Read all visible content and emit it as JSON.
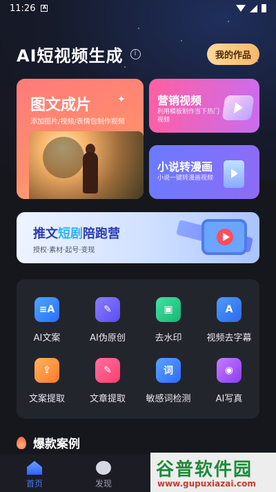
{
  "status_bar": {
    "time": "11:26",
    "a_badge": "A"
  },
  "header": {
    "title": "AI短视频生成",
    "info_glyph": "i",
    "my_works_label": "我的作品"
  },
  "cards": {
    "big": {
      "title": "图文成片",
      "subtitle": "添加图片/视频/表情包制作视频"
    },
    "top_right": {
      "title": "营销视频",
      "subtitle": "利用模板制作当下热门视频"
    },
    "bottom_right": {
      "title": "小说转漫画",
      "subtitle": "小说一键转漫画视频"
    }
  },
  "banner": {
    "title_part1": "推文",
    "title_highlight": "短剧",
    "title_part2": "陪跑营",
    "subtitle": "授权·素材·起号·变现"
  },
  "tools": [
    {
      "label": "AI文案",
      "icon": "ai-copywriting-icon",
      "glyph": "≡A",
      "color1": "#4aa8ff",
      "color2": "#2f6bff"
    },
    {
      "label": "AI伪原创",
      "icon": "ai-rewrite-icon",
      "glyph": "✎",
      "color1": "#8a7dff",
      "color2": "#5c4df0"
    },
    {
      "label": "去水印",
      "icon": "remove-watermark-icon",
      "glyph": "▣",
      "color1": "#46e0a0",
      "color2": "#14b873"
    },
    {
      "label": "视频去字幕",
      "icon": "remove-subtitle-icon",
      "glyph": "A",
      "color1": "#4a9dff",
      "color2": "#2f68e8"
    },
    {
      "label": "文案提取",
      "icon": "text-extract-icon",
      "glyph": "⇪",
      "color1": "#ffb35c",
      "color2": "#ff7a2a"
    },
    {
      "label": "文章提取",
      "icon": "article-extract-icon",
      "glyph": "✎",
      "color1": "#ff6fa0",
      "color2": "#ff3f6f"
    },
    {
      "label": "敏感词检测",
      "icon": "sensitive-words-icon",
      "glyph": "词",
      "color1": "#5aa2ff",
      "color2": "#2f6bff"
    },
    {
      "label": "AI写真",
      "icon": "ai-portrait-icon",
      "glyph": "◉",
      "color1": "#c77bff",
      "color2": "#8a3df0"
    }
  ],
  "section": {
    "title": "爆款案例"
  },
  "nav": [
    {
      "label": "首页",
      "icon": "home-icon",
      "active": true
    },
    {
      "label": "发现",
      "icon": "discover-icon",
      "active": false
    }
  ],
  "watermark": {
    "brand": "谷普软件园",
    "url": "www.gupuxiazai.com"
  }
}
